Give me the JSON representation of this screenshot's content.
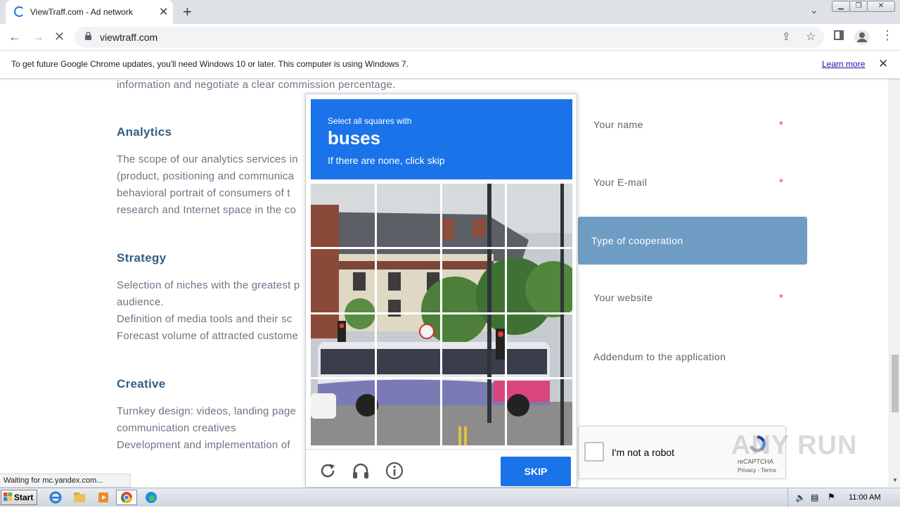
{
  "browser": {
    "tab_title": "ViewTraff.com - Ad network",
    "url": "viewtraff.com",
    "infobar_message": "To get future Google Chrome updates, you'll need Windows 10 or later. This computer is using Windows 7.",
    "infobar_link": "Learn more",
    "status_text": "Waiting for mc.yandex.com..."
  },
  "page": {
    "intro_tail": "information and negotiate a clear commission percentage.",
    "sections": [
      {
        "heading": "Analytics",
        "lines": [
          "The scope of our analytics services in",
          "(product, positioning and communica",
          "behavioral portrait of consumers of t",
          "research and Internet space in the co"
        ]
      },
      {
        "heading": "Strategy",
        "lines": [
          "Selection of niches with the greatest p",
          "audience.",
          "Definition of media tools and their sc",
          "Forecast volume of attracted custome"
        ]
      },
      {
        "heading": "Creative",
        "lines": [
          "Turnkey design: videos, landing page",
          "communication creatives",
          "Development and implementation of"
        ]
      }
    ],
    "form": {
      "name_label": "Your name",
      "email_label": "Your E-mail",
      "cooperation_label": "Type of cooperation",
      "website_label": "Your website",
      "addendum_label": "Addendum to the application",
      "required_mark": "*"
    },
    "recaptcha": {
      "label": "I'm not a robot",
      "brand": "reCAPTCHA",
      "links": "Privacy - Terms"
    },
    "watermark": "ANY RUN"
  },
  "challenge": {
    "instruction": "Select all squares with",
    "target": "buses",
    "note": "If there are none, click skip",
    "skip_label": "SKIP",
    "grid_size": "4x4",
    "icons": [
      "reload-icon",
      "audio-icon",
      "info-icon"
    ],
    "accent": "#1a73e8"
  },
  "taskbar": {
    "start_label": "Start",
    "apps": [
      "ie-icon",
      "explorer-icon",
      "media-player-icon",
      "chrome-icon",
      "edge-icon"
    ],
    "clock": "11:00 AM"
  }
}
